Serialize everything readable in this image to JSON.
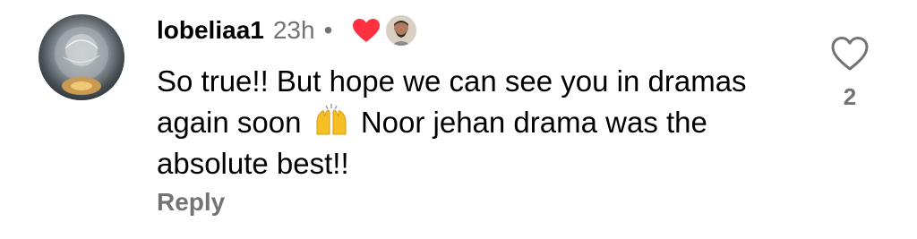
{
  "comment": {
    "username": "lobeliaa1",
    "timestamp": "23h",
    "separator": "•",
    "creator_liked": true,
    "text_before_emoji": "So true!! But hope we can see you in dramas again soon",
    "emoji": "raising-hands",
    "text_after_emoji": "Noor jehan drama was the absolute best!!",
    "reply_label": "Reply",
    "like_count": "2"
  },
  "colors": {
    "text": "#000000",
    "muted": "#737373",
    "heart": "#ff3040"
  },
  "icons": {
    "like": "heart-outline-icon",
    "creator_like": "red-heart-icon",
    "emoji": "raising-hands-emoji-icon"
  }
}
